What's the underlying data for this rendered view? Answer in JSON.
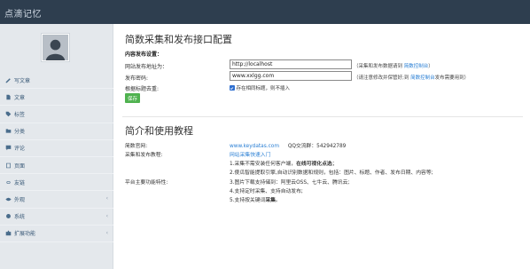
{
  "app": {
    "brand": "点滴记忆"
  },
  "sidebar": {
    "items": [
      {
        "label": "写文章",
        "icon": "edit-icon",
        "chevron": ""
      },
      {
        "label": "文章",
        "icon": "document-icon",
        "chevron": ""
      },
      {
        "label": "标签",
        "icon": "tag-icon",
        "chevron": ""
      },
      {
        "label": "分类",
        "icon": "folder-icon",
        "chevron": ""
      },
      {
        "label": "评论",
        "icon": "comment-icon",
        "chevron": ""
      },
      {
        "label": "页面",
        "icon": "page-icon",
        "chevron": ""
      },
      {
        "label": "友链",
        "icon": "link-icon",
        "chevron": ""
      },
      {
        "label": "外观",
        "icon": "eye-icon",
        "chevron": "‹"
      },
      {
        "label": "系统",
        "icon": "gear-icon",
        "chevron": "‹"
      },
      {
        "label": "扩展功能",
        "icon": "puzzle-icon",
        "chevron": "‹"
      }
    ]
  },
  "config": {
    "title": "简数采集和发布接口配置",
    "subtitle": "内容发布设置：",
    "site_label": "网站发布地址为：",
    "site_value": "http://localhost",
    "site_hint_prefix": "（采集和发布数据请到 ",
    "site_hint_link": "简数控制台",
    "site_hint_suffix": "）",
    "password_label": "发布密码:",
    "password_value": "www.xxlgg.com",
    "password_hint_prefix": "（请注意修改并保管好;到 ",
    "password_hint_link": "简数控制台",
    "password_hint_suffix": "发布需要用到）",
    "dedupe_label": "根据标题去重:",
    "dedupe_text": "存在相同标题，则不插入",
    "save_label": "保存"
  },
  "intro": {
    "title": "简介和使用教程",
    "site_label": "简数官网:",
    "site_link": "www.keydatas.com",
    "qq_text": "QQ交流群：542942789",
    "tutorial_label": "采集和发布教程:",
    "tutorial_link": "网站采集快速入门",
    "features_label": "平台主要功能特性:",
    "features": [
      {
        "text": "1.采集不需安装任何客户端，在线可视化点选；",
        "bold": "在线可视化点选"
      },
      {
        "text": "2.傻瓜智能提取引擎,自动识别数据和规则，包括：图片、标题、作者、发布日期、内容等;",
        "bold": ""
      },
      {
        "text": "3.图片下载支持储到：阿里云OSS、七牛云、腾讯云;",
        "bold": ""
      },
      {
        "text": "4.支持定时采集、支持自动发布;",
        "bold": ""
      },
      {
        "text": "5.支持按关键词采集。",
        "bold": "采集"
      }
    ]
  }
}
